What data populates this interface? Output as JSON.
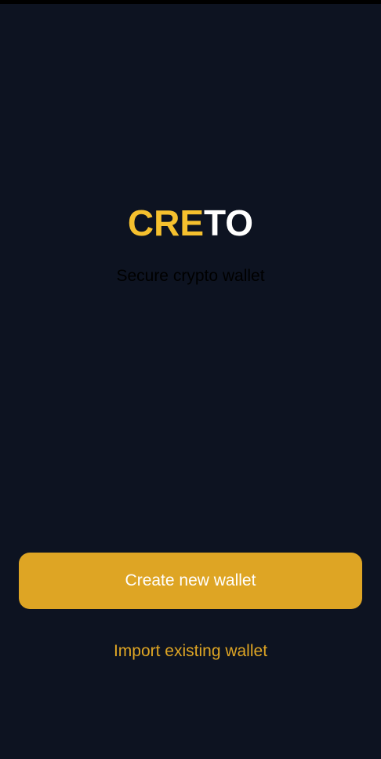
{
  "logo": {
    "accent_text": "CRE",
    "rest_text": "TO"
  },
  "tagline": "Secure crypto wallet",
  "actions": {
    "create_label": "Create new wallet",
    "import_label": "Import existing wallet"
  },
  "colors": {
    "background": "#0d1321",
    "accent": "#f5c02e",
    "button": "#dea524",
    "button_text": "#ffffff"
  }
}
